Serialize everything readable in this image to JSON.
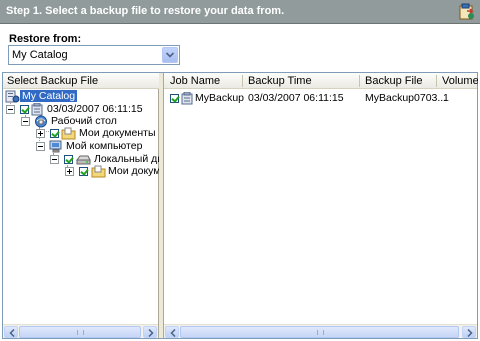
{
  "header": {
    "title": "Step 1. Select a backup file to restore your data from."
  },
  "restore": {
    "label": "Restore from:",
    "selected": "My Catalog"
  },
  "left_pane": {
    "header": "Select Backup File",
    "tree": {
      "root": "My Catalog",
      "backup": "03/03/2007 06:11:15",
      "desktop": "Рабочий стол",
      "my_documents": "Мои документы",
      "my_computer": "Мой компьютер",
      "local_disk": "Локальный диск",
      "my_documents_2": "Мои докумен"
    }
  },
  "right_pane": {
    "columns": [
      "Job Name",
      "Backup Time",
      "Backup File",
      "Volumes"
    ],
    "rows": [
      {
        "job_name": "MyBackup",
        "backup_time": "03/03/2007 06:11:15",
        "backup_file": "MyBackup0703...",
        "volumes": "1"
      }
    ]
  },
  "icons": {
    "header": "restore-wizard-icon",
    "catalog": "catalog-icon",
    "backup_job": "backup-job-icon",
    "desktop": "desktop-icon",
    "folder": "folder-icon",
    "computer": "computer-icon",
    "drive": "drive-icon"
  },
  "colors": {
    "header_bg": "#919b9c",
    "selection": "#316ac5",
    "check": "#21a121"
  }
}
